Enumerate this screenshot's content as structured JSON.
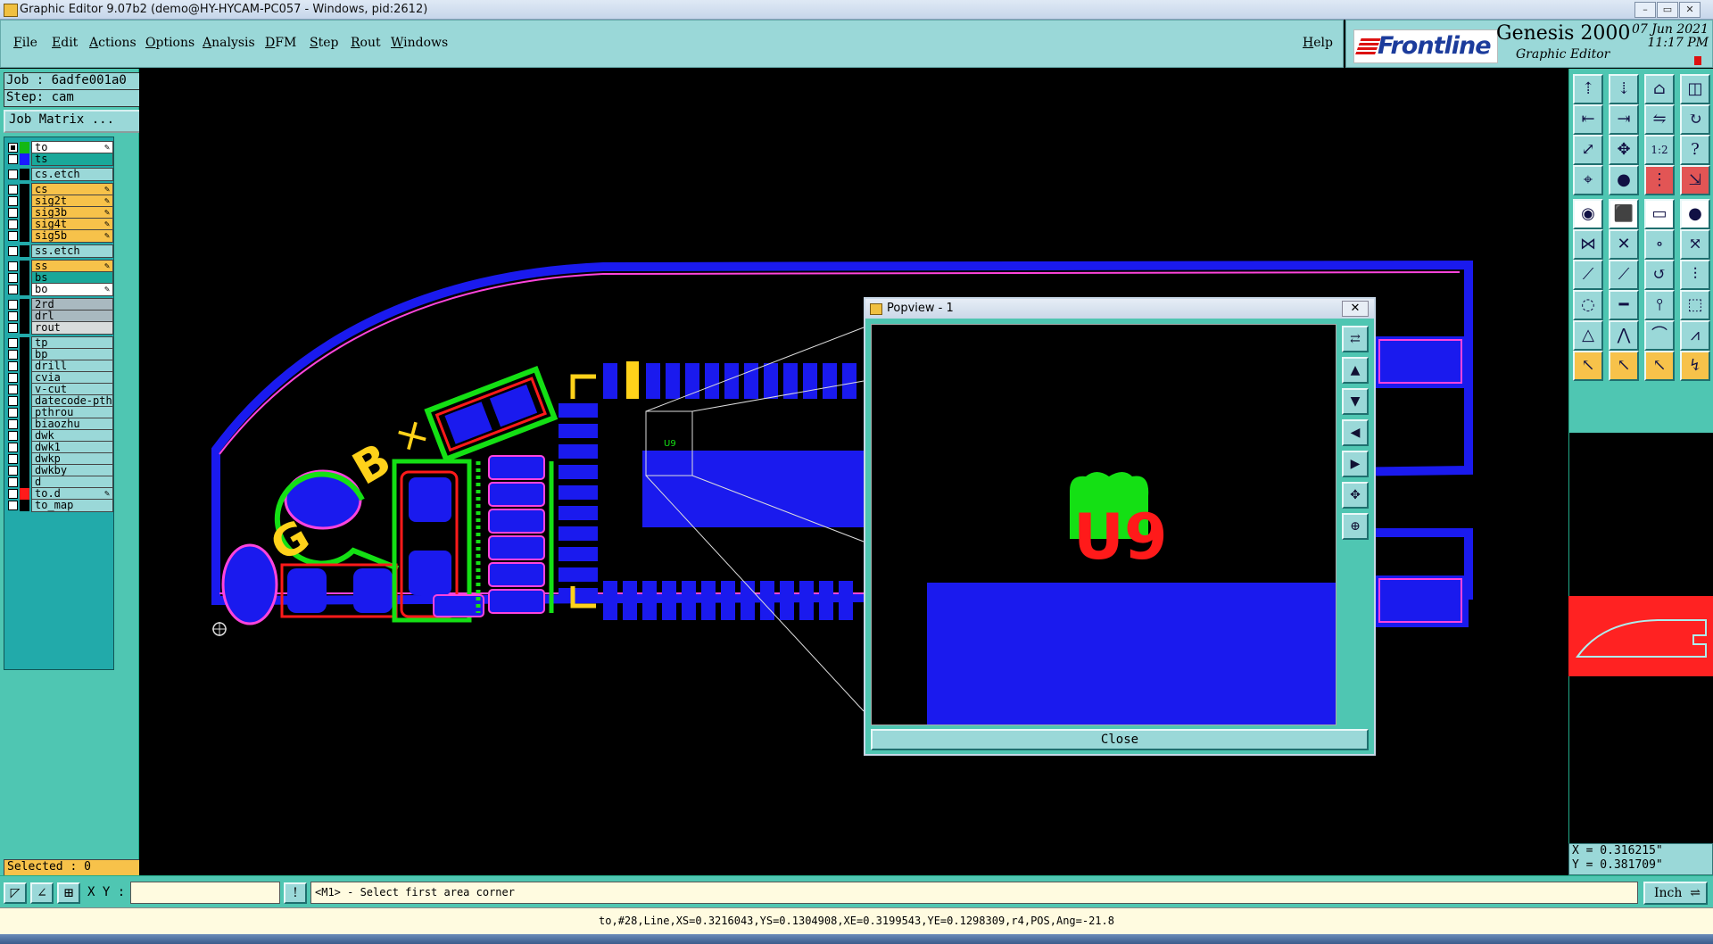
{
  "window": {
    "title": "Graphic Editor 9.07b2 (demo@HY-HYCAM-PC057 - Windows, pid:2612)"
  },
  "menu": {
    "items": [
      "File",
      "Edit",
      "Actions",
      "Options",
      "Analysis",
      "DFM",
      "Step",
      "Rout",
      "Windows"
    ],
    "help": "Help"
  },
  "brand": {
    "logo": "Frontline",
    "product": "Genesis 2000",
    "subtitle": "Graphic Editor",
    "date": "07 Jun 2021",
    "time": "11:17 PM"
  },
  "job": {
    "job_line": "Job : 6adfe001a0",
    "step_line": "Step: cam",
    "matrix_button": "Job Matrix ..."
  },
  "layers": [
    {
      "name": "to",
      "bg": "#ffffff",
      "swatch": "#14b814",
      "checked": true,
      "pen": true
    },
    {
      "name": "ts",
      "bg": "#1aa89a",
      "swatch": "#1a1aff",
      "checked": false,
      "pen": false
    },
    {
      "name": "cs.etch",
      "bg": "#9ad8d8",
      "swatch": "#000000",
      "checked": false,
      "pen": false,
      "gap": true
    },
    {
      "name": "cs",
      "bg": "#f7c24a",
      "swatch": "#000000",
      "checked": false,
      "pen": true,
      "gap": true
    },
    {
      "name": "sig2t",
      "bg": "#f7c24a",
      "swatch": "#000000",
      "checked": false,
      "pen": true
    },
    {
      "name": "sig3b",
      "bg": "#f7c24a",
      "swatch": "#000000",
      "checked": false,
      "pen": true
    },
    {
      "name": "sig4t",
      "bg": "#f7c24a",
      "swatch": "#000000",
      "checked": false,
      "pen": true
    },
    {
      "name": "sig5b",
      "bg": "#f7c24a",
      "swatch": "#000000",
      "checked": false,
      "pen": true
    },
    {
      "name": "ss.etch",
      "bg": "#9ad8d8",
      "swatch": "#000000",
      "checked": false,
      "pen": false,
      "gap": true
    },
    {
      "name": "ss",
      "bg": "#f7c24a",
      "swatch": "#000000",
      "checked": false,
      "pen": true,
      "gap": true
    },
    {
      "name": "bs",
      "bg": "#1aa89a",
      "swatch": "#000000",
      "checked": false,
      "pen": false
    },
    {
      "name": "bo",
      "bg": "#ffffff",
      "swatch": "#000000",
      "checked": false,
      "pen": true
    },
    {
      "name": "2rd",
      "bg": "#a9b9c0",
      "swatch": "#000000",
      "checked": false,
      "pen": false,
      "gap": true
    },
    {
      "name": "drl",
      "bg": "#a9b9c0",
      "swatch": "#000000",
      "checked": false,
      "pen": false
    },
    {
      "name": "rout",
      "bg": "#d8dcdc",
      "swatch": "#000000",
      "checked": false,
      "pen": false
    },
    {
      "name": "tp",
      "bg": "#9ad8d8",
      "swatch": "#000000",
      "checked": false,
      "pen": false,
      "gap": true
    },
    {
      "name": "bp",
      "bg": "#9ad8d8",
      "swatch": "#000000",
      "checked": false,
      "pen": false
    },
    {
      "name": "drill",
      "bg": "#9ad8d8",
      "swatch": "#000000",
      "checked": false,
      "pen": false
    },
    {
      "name": "cvia",
      "bg": "#9ad8d8",
      "swatch": "#000000",
      "checked": false,
      "pen": false
    },
    {
      "name": "v-cut",
      "bg": "#9ad8d8",
      "swatch": "#000000",
      "checked": false,
      "pen": false
    },
    {
      "name": "datecode-pth",
      "bg": "#9ad8d8",
      "swatch": "#000000",
      "checked": false,
      "pen": false
    },
    {
      "name": "pthrou",
      "bg": "#9ad8d8",
      "swatch": "#000000",
      "checked": false,
      "pen": false
    },
    {
      "name": "biaozhu",
      "bg": "#9ad8d8",
      "swatch": "#000000",
      "checked": false,
      "pen": false
    },
    {
      "name": "dwk",
      "bg": "#9ad8d8",
      "swatch": "#000000",
      "checked": false,
      "pen": false
    },
    {
      "name": "dwk1",
      "bg": "#9ad8d8",
      "swatch": "#000000",
      "checked": false,
      "pen": false
    },
    {
      "name": "dwkp",
      "bg": "#9ad8d8",
      "swatch": "#000000",
      "checked": false,
      "pen": false
    },
    {
      "name": "dwkby",
      "bg": "#9ad8d8",
      "swatch": "#000000",
      "checked": false,
      "pen": false
    },
    {
      "name": "d",
      "bg": "#9ad8d8",
      "swatch": "#000000",
      "checked": false,
      "pen": false
    },
    {
      "name": "to.d",
      "bg": "#9ad8d8",
      "swatch": "#ff1a1a",
      "checked": false,
      "pen": true
    },
    {
      "name": "to_map",
      "bg": "#9ad8d8",
      "swatch": "#000000",
      "checked": false,
      "pen": false
    }
  ],
  "selected": "Selected : 0",
  "popview": {
    "title": "Popview - 1",
    "close": "Close",
    "label": "U9"
  },
  "coords": {
    "x": "X = 0.316215\"",
    "y": "Y = 0.381709\""
  },
  "command": {
    "xy_label": "X Y :",
    "xy_value": "",
    "message": "<M1> - Select first area corner",
    "unit": "Inch"
  },
  "status": "to,#28,Line,XS=0.3216043,YS=0.1304908,XE=0.3199543,YE=0.1298309,r4,POS,Ang=-21.8",
  "colors": {
    "panel_teal": "#4fc6b2",
    "button_teal": "#9ad8d8",
    "copper_blue": "#1a1aee",
    "silk_green": "#14e014",
    "outline_red": "#ff1a1a",
    "silk_yellow": "#ffd21a",
    "outline_pink": "#ff44dd"
  },
  "icons": {
    "right_toolbar": [
      "layer-up-icon",
      "layer-down-icon",
      "home-icon",
      "window-icon",
      "pan-left-icon",
      "pan-right-icon",
      "swap-icon",
      "redraw-icon",
      "zoom-fit-icon",
      "zoom-area-icon",
      "ratio-icon",
      "help-icon",
      "snap-icon",
      "measure-icon",
      "graph-icon",
      "fit-icon",
      "pad-icon",
      "line-icon",
      "ruler-icon",
      "circle-icon",
      "connect-icon",
      "cross-icon",
      "node-icon",
      "split-icon",
      "slope-icon",
      "draw-line-icon",
      "arc-icon",
      "align-icon",
      "drop-icon",
      "minus-icon",
      "pin-icon",
      "group-icon",
      "triangle-icon",
      "polygon-icon",
      "arch-icon",
      "peak-icon",
      "pointer-icon",
      "select-icon",
      "move-icon",
      "route-icon"
    ]
  }
}
